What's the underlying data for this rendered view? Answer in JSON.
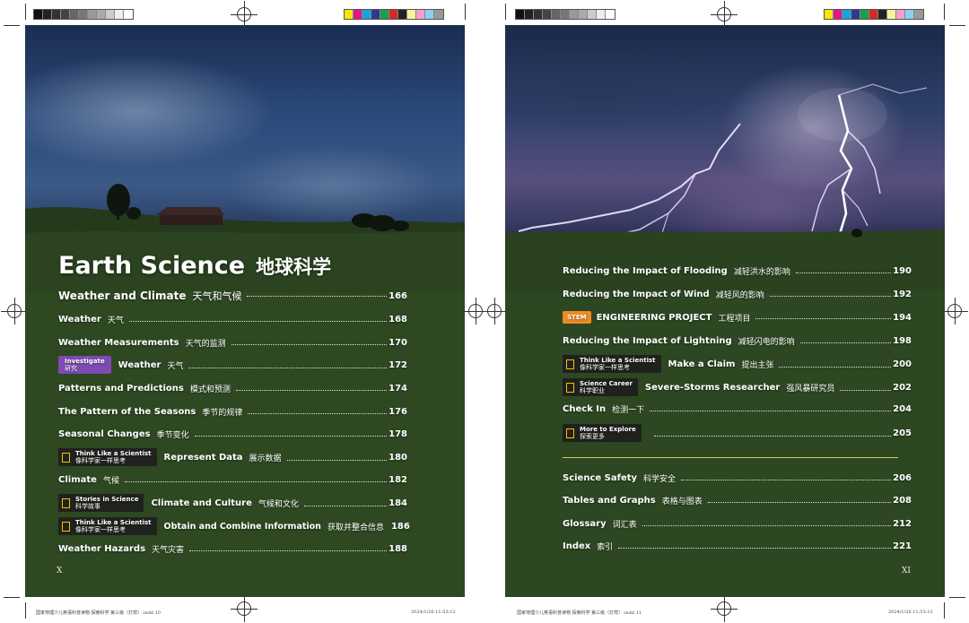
{
  "left_page": {
    "title": "Earth Science",
    "title_zh": "地球科学",
    "folio": "X",
    "entries": [
      {
        "en": "Weather and Climate",
        "zh": "天气和气候",
        "page": "166"
      },
      {
        "en": "Weather",
        "zh": "天气",
        "page": "168"
      },
      {
        "en": "Weather Measurements",
        "zh": "天气的监测",
        "page": "170"
      },
      {
        "tag": "Investigate",
        "tag_zh": "研究",
        "en": "Weather",
        "zh": "天气",
        "page": "172"
      },
      {
        "en": "Patterns and Predictions",
        "zh": "模式和预测",
        "page": "174"
      },
      {
        "en": "The Pattern of the Seasons",
        "zh": "季节的规律",
        "page": "176"
      },
      {
        "en": "Seasonal Changes",
        "zh": "季节变化",
        "page": "178"
      },
      {
        "tag": "Think Like a Scientist",
        "tag_zh": "像科学家一样思考",
        "en": "Represent Data",
        "zh": "展示数据",
        "page": "180"
      },
      {
        "en": "Climate",
        "zh": "气候",
        "page": "182"
      },
      {
        "tag": "Stories in Science",
        "tag_zh": "科学故事",
        "en": "Climate and Culture",
        "zh": "气候和文化",
        "page": "184"
      },
      {
        "tag": "Think Like a Scientist",
        "tag_zh": "像科学家一样思考",
        "en": "Obtain and Combine Information",
        "zh": "获取并整合信息",
        "page": "186"
      },
      {
        "en": "Weather Hazards",
        "zh": "天气灾害",
        "page": "188"
      }
    ]
  },
  "right_page": {
    "folio": "XI",
    "entries": [
      {
        "en": "Reducing the Impact of Flooding",
        "zh": "减轻洪水的影响",
        "page": "190"
      },
      {
        "en": "Reducing the Impact of Wind",
        "zh": "减轻风的影响",
        "page": "192"
      },
      {
        "stem": "STEM",
        "en": "ENGINEERING PROJECT",
        "zh": "工程项目",
        "page": "194"
      },
      {
        "en": "Reducing the Impact of Lightning",
        "zh": "减轻闪电的影响",
        "page": "198"
      },
      {
        "tag": "Think Like a Scientist",
        "tag_zh": "像科学家一样思考",
        "en": "Make a Claim",
        "zh": "提出主张",
        "page": "200"
      },
      {
        "tag": "Science Career",
        "tag_zh": "科学职业",
        "en": "Severe-Storms Researcher",
        "zh": "强风暴研究员",
        "page": "202"
      },
      {
        "en": "Check In",
        "zh": "检测一下",
        "page": "204"
      },
      {
        "tag": "More to Explore",
        "tag_zh": "探索更多",
        "en": "",
        "zh": "",
        "page": "205"
      }
    ],
    "back_matter": [
      {
        "en": "Science Safety",
        "zh": "科学安全",
        "page": "206"
      },
      {
        "en": "Tables and Graphs",
        "zh": "表格与图表",
        "page": "208"
      },
      {
        "en": "Glossary",
        "zh": "词汇表",
        "page": "212"
      },
      {
        "en": "Index",
        "zh": "索引",
        "page": "221"
      }
    ]
  },
  "slug": {
    "left_file": "国家地理少儿英语科普读物 探索科学 第三级（打样）.indd 10",
    "left_date": "2024/1/26   11:53:12",
    "right_file": "国家地理少儿英语科普读物 探索科学 第三级（打样）.indd 11",
    "right_date": "2024/1/26   11:53:13"
  },
  "colors": {
    "investigate_tag": "#7e4bb3",
    "stem_badge": "#f08a24",
    "feature_icon": "#f5c400",
    "divider": "#c8d04a"
  }
}
